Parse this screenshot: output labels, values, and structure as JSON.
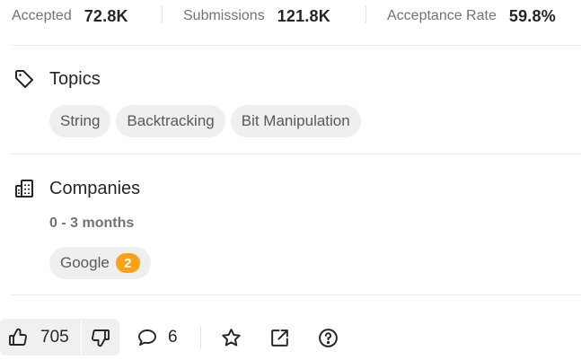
{
  "stats": {
    "accepted_label": "Accepted",
    "accepted_value": "72.8K",
    "submissions_label": "Submissions",
    "submissions_value": "121.8K",
    "acceptance_rate_label": "Acceptance Rate",
    "acceptance_rate_value": "59.8%"
  },
  "topics": {
    "title": "Topics",
    "icon": "tag-icon",
    "tags": [
      "String",
      "Backtracking",
      "Bit Manipulation"
    ]
  },
  "companies": {
    "title": "Companies",
    "icon": "building-icon",
    "period": "0 - 3 months",
    "items": [
      {
        "name": "Google",
        "count": "2"
      }
    ]
  },
  "actions": {
    "upvotes": "705",
    "comments": "6",
    "upvote_icon": "thumbs-up-icon",
    "downvote_icon": "thumbs-down-icon",
    "comment_icon": "comment-icon",
    "favorite_icon": "star-icon",
    "share_icon": "external-link-icon",
    "help_icon": "question-icon"
  },
  "colors": {
    "accent_badge": "#ffa116",
    "chip_bg": "#efefef",
    "muted_text": "#737373"
  }
}
